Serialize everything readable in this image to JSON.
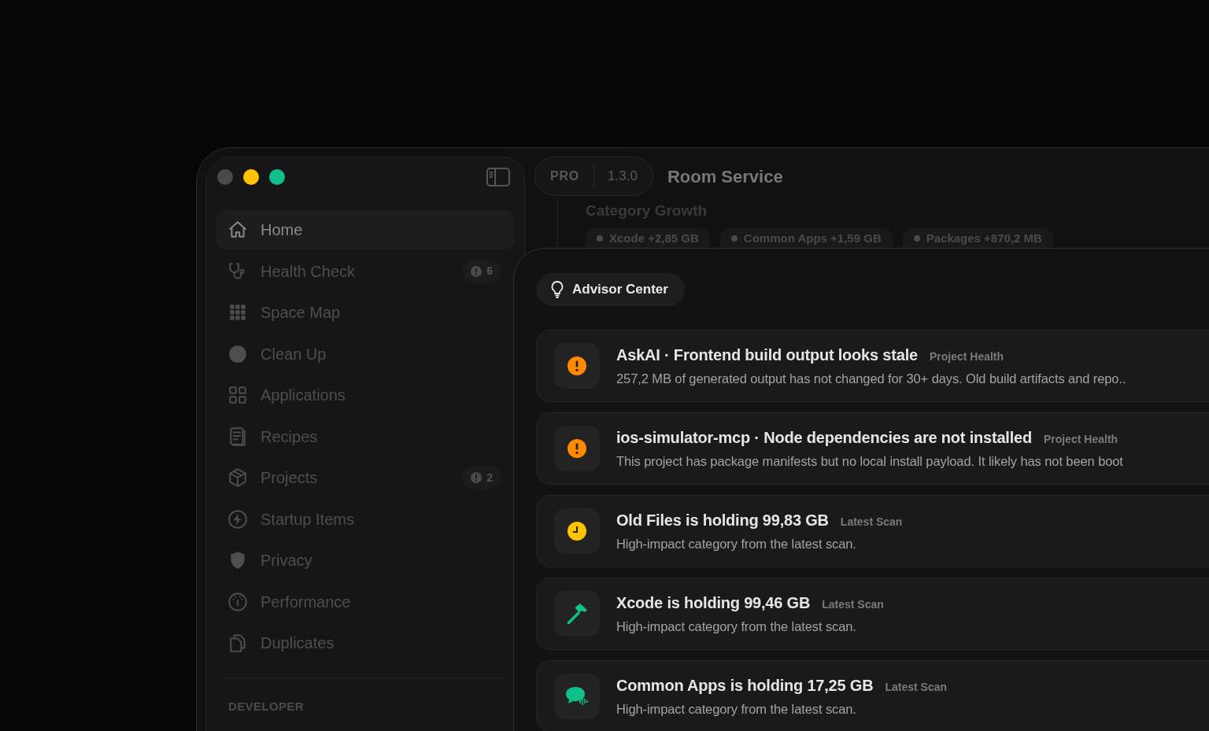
{
  "sidebar": {
    "items": [
      {
        "label": "Home",
        "selected": true
      },
      {
        "label": "Health Check",
        "selected": false,
        "badge": "6"
      },
      {
        "label": "Space Map",
        "selected": false
      },
      {
        "label": "Clean Up",
        "selected": false
      },
      {
        "label": "Applications",
        "selected": false
      },
      {
        "label": "Recipes",
        "selected": false
      },
      {
        "label": "Projects",
        "selected": false,
        "badge": "2"
      },
      {
        "label": "Startup Items",
        "selected": false
      },
      {
        "label": "Privacy",
        "selected": false
      },
      {
        "label": "Performance",
        "selected": false
      },
      {
        "label": "Duplicates",
        "selected": false
      }
    ],
    "section": "DEVELOPER"
  },
  "header": {
    "plan": "PRO",
    "version": "1.3.0",
    "title": "Room Service"
  },
  "background_section": {
    "title": "Category Growth",
    "chips": [
      "Xcode +2,85 GB",
      "Common Apps +1,59 GB",
      "Packages +870,2 MB"
    ]
  },
  "advisor": {
    "title": "Advisor Center",
    "cards": [
      {
        "title": "AskAI · Frontend build output looks stale",
        "tag": "Project Health",
        "description": "257,2 MB of generated output has not changed for 30+ days. Old build artifacts and repo..",
        "color": "#ff8a00"
      },
      {
        "title": "ios-simulator-mcp · Node dependencies are not installed",
        "tag": "Project Health",
        "description": "This project has package manifests but no local install payload. It likely has not been boot",
        "color": "#ff8a00"
      },
      {
        "title": "Old Files is holding 99,83 GB",
        "tag": "Latest Scan",
        "description": "High-impact category from the latest scan.",
        "color": "#ffc400"
      },
      {
        "title": "Xcode is holding 99,46 GB",
        "tag": "Latest Scan",
        "description": "High-impact category from the latest scan.",
        "color": "#10c08a"
      },
      {
        "title": "Common Apps is holding 17,25 GB",
        "tag": "Latest Scan",
        "description": "High-impact category from the latest scan.",
        "color": "#10c08a"
      }
    ]
  }
}
